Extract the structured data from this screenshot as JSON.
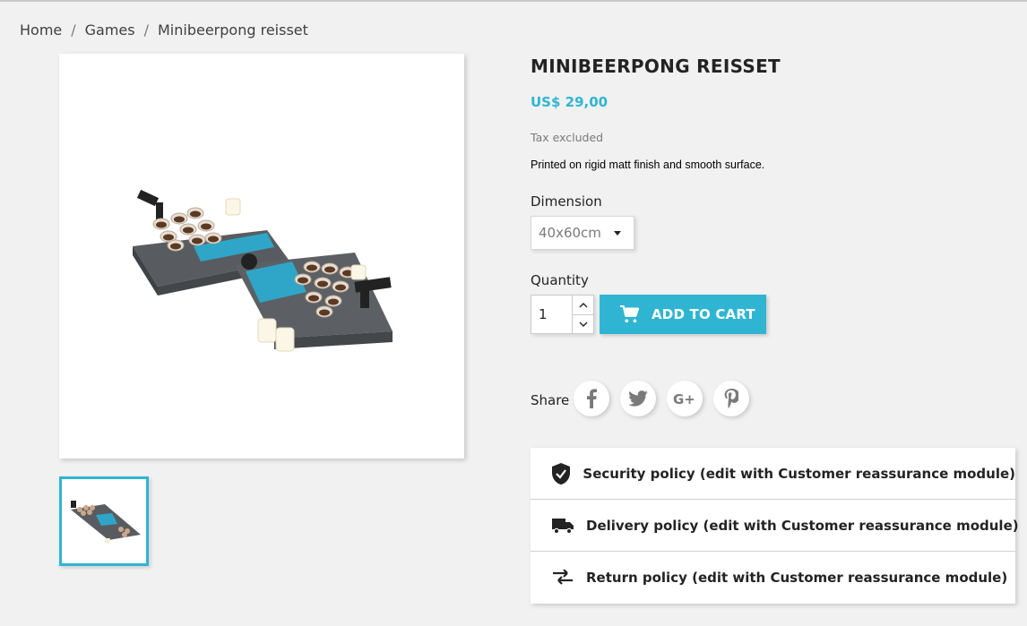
{
  "breadcrumb": {
    "home": "Home",
    "category": "Games",
    "current": "Minibeerpong reisset",
    "separator": "/"
  },
  "product": {
    "title": "MINIBEERPONG REISSET",
    "price": "US$ 29,00",
    "tax_note": "Tax excluded",
    "description": "Printed on rigid matt finish and smooth surface."
  },
  "dimension": {
    "label": "Dimension",
    "selected": "40x60cm"
  },
  "quantity": {
    "label": "Quantity",
    "value": "1"
  },
  "cart": {
    "label": "ADD TO CART",
    "icon": "cart-icon"
  },
  "share": {
    "label": "Share",
    "networks": [
      "facebook-icon",
      "twitter-icon",
      "google-plus-icon",
      "pinterest-icon"
    ]
  },
  "reassurance": [
    {
      "icon": "shield-icon",
      "text": "Security policy (edit with Customer reassurance module)"
    },
    {
      "icon": "truck-icon",
      "text": "Delivery policy (edit with Customer reassurance module)"
    },
    {
      "icon": "exchange-arrows-icon",
      "text": "Return policy (edit with Customer reassurance module)"
    }
  ],
  "colors": {
    "accent": "#2fb5d2",
    "text": "#232323",
    "muted": "#7a7a7a",
    "background": "#f1f1f1"
  }
}
